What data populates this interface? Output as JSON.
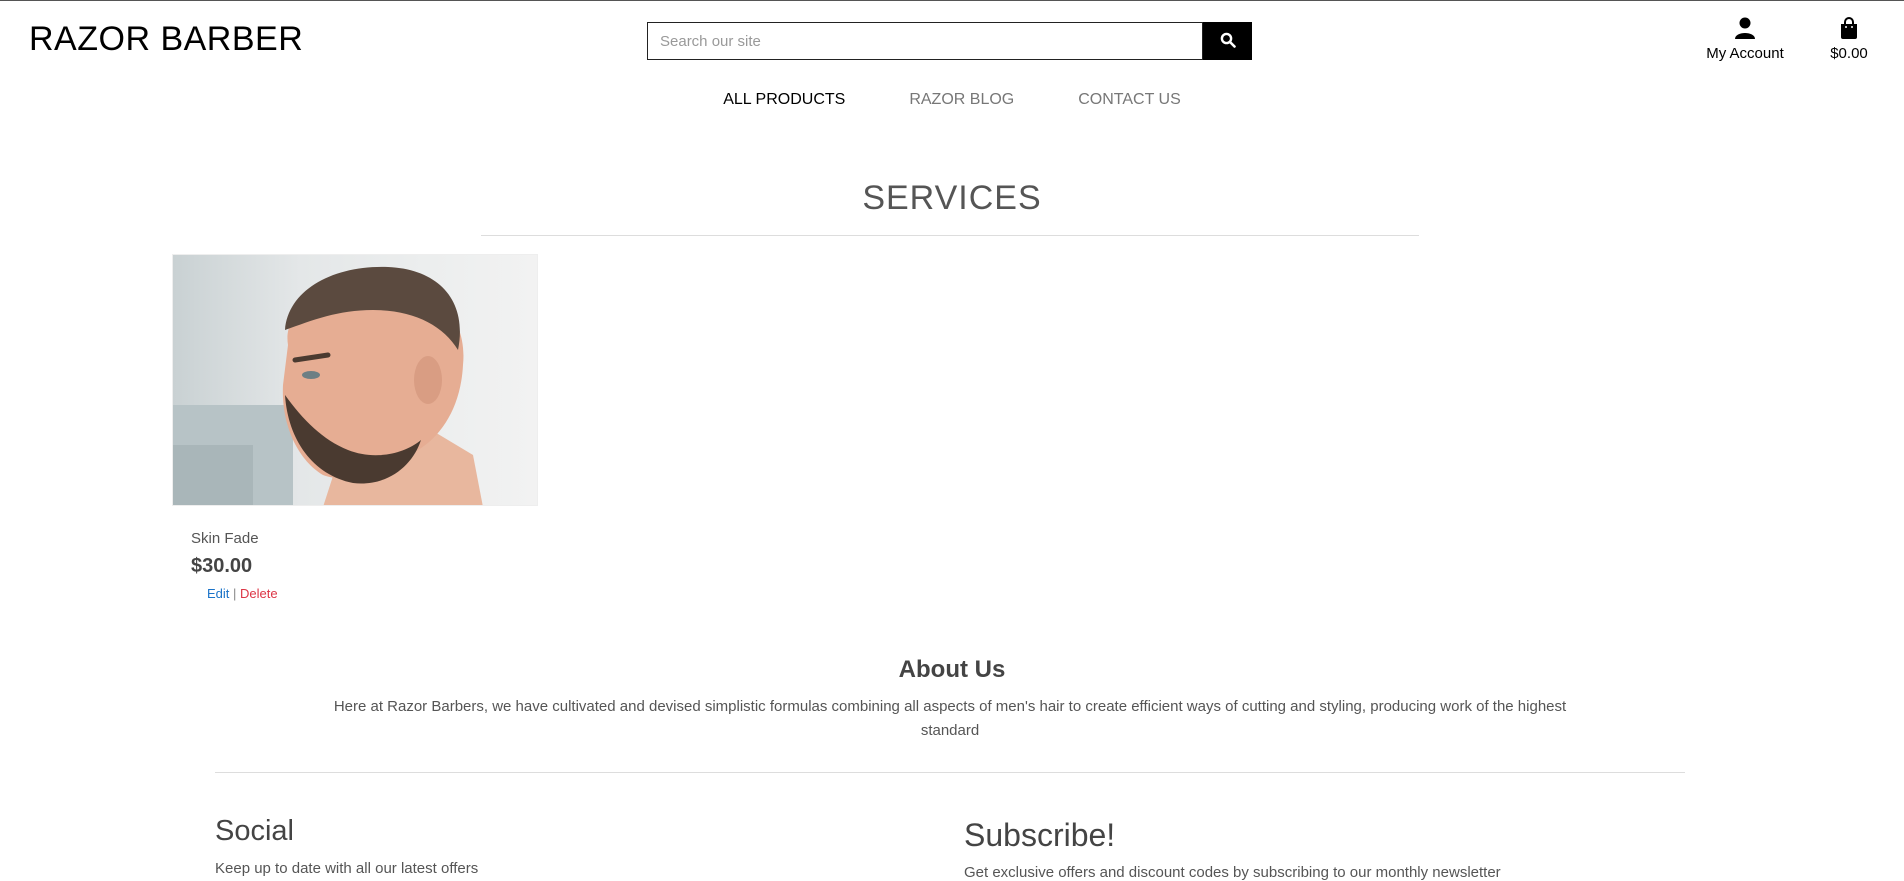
{
  "header": {
    "brand": "RAZOR BARBER",
    "search": {
      "placeholder": "Search our site",
      "value": ""
    },
    "account_label": "My Account",
    "cart_total": "$0.00"
  },
  "nav": {
    "items": [
      {
        "label": "ALL PRODUCTS",
        "active": true
      },
      {
        "label": "RAZOR BLOG",
        "active": false
      },
      {
        "label": "CONTACT US",
        "active": false
      }
    ]
  },
  "services": {
    "title": "SERVICES",
    "products": [
      {
        "name": "Skin Fade",
        "price": "$30.00",
        "edit_label": "Edit",
        "separator": "|",
        "delete_label": "Delete"
      }
    ]
  },
  "about": {
    "title": "About Us",
    "text": "Here at Razor Barbers, we have cultivated and devised simplistic formulas combining all aspects of men's hair to create efficient ways of cutting and styling, producing work of the highest standard"
  },
  "footer": {
    "social_title": "Social",
    "social_text": "Keep up to date with all our latest offers",
    "subscribe_title": "Subscribe!",
    "subscribe_text": "Get exclusive offers and discount codes by subscribing to our monthly newsletter"
  },
  "icons": {
    "search": "search-icon",
    "account": "user-icon",
    "cart": "shopping-bag-icon"
  },
  "colors": {
    "edit_link": "#1a73c8",
    "delete_link": "#dc3545",
    "search_button": "#000000"
  }
}
